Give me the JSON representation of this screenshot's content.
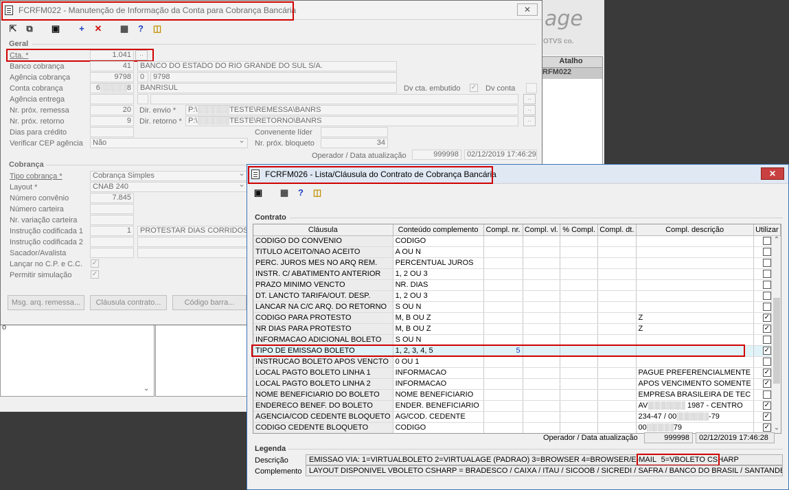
{
  "background": {
    "logo_text": "age",
    "logo_sub": "OTVS co.",
    "table_header": "Atalho",
    "table_cell": "RFM022",
    "stray_text": "o"
  },
  "win1": {
    "title": "FCRFM022 - Manutenção de Informação da Conta para Cobrança Bancária",
    "geral": {
      "group_label": "Geral",
      "cta_label": "Cta. *",
      "cta_value": "1.041",
      "banco_label": "Banco cobrança",
      "banco_code": "41",
      "banco_name": "BANCO DO ESTADO DO RIO GRANDE DO SUL S/A.",
      "agencia_label": "Agência cobrança",
      "agencia_code": "9798",
      "agencia_digit": "0",
      "agencia_name": "9798",
      "conta_label": "Conta cobrança",
      "conta_value": "6░░░░░8",
      "conta_name": "BANRISUL",
      "dv_embutido_label": "Dv cta. embutido",
      "dv_conta_label": "Dv conta",
      "agencia_entrega_label": "Agência entrega",
      "nr_remessa_label": "Nr. próx. remessa",
      "nr_remessa_value": "20",
      "dir_envio_label": "Dir. envio *",
      "dir_envio_value": "P:\\░░░░░░TESTE\\REMESSA\\BANRS",
      "nr_retorno_label": "Nr. próx. retorno",
      "nr_retorno_value": "9",
      "dir_retorno_label": "Dir. retorno *",
      "dir_retorno_value": "P:\\░░░░░░TESTE\\RETORNO\\BANRS",
      "dias_credito_label": "Dias para crédito",
      "convenente_label": "Convenente líder",
      "cep_label": "Verificar CEP agência",
      "cep_value": "Não",
      "nr_bloqueto_label": "Nr. próx. bloqueto",
      "nr_bloqueto_value": "34",
      "operador_label": "Operador / Data atualização",
      "operador_value": "999998",
      "data_value": "02/12/2019 17:46:29"
    },
    "cobranca": {
      "group_label": "Cobrança",
      "tipo_label": "Tipo cobrança *",
      "tipo_value": "Cobrança Simples",
      "layout_label": "Layout *",
      "layout_value": "CNAB 240",
      "convenio_label": "Número convênio",
      "convenio_value": "7.845",
      "carteira_label": "Número carteira",
      "variacao_label": "Nr. variação carteira",
      "instr1_label": "Instrução codificada 1",
      "instr1_value": "1",
      "instr1_desc": "PROTESTAR DIAS CORRIDOS",
      "instr2_label": "Instrução codificada 2",
      "sacador_label": "Sacador/Avalista",
      "lancar_label": "Lançar no C.P. e C.C.",
      "simulacao_label": "Permitir simulação"
    },
    "buttons": {
      "msg": "Msg. arq. remessa...",
      "clausula": "Cláusula contrato...",
      "codigo_barra": "Código barra..."
    }
  },
  "win2": {
    "title": "FCRFM026 - Lista/Cláusula do Contrato de Cobrança Bancária",
    "close": "✕",
    "group_label": "Contrato",
    "columns": [
      "Cláusula",
      "Conteúdo complemento",
      "Compl. nr.",
      "Compl. vl.",
      "% Compl.",
      "Compl. dt.",
      "Compl. descrição",
      "Utilizar"
    ],
    "rows": [
      {
        "clausula": "CODIGO DO CONVENIO",
        "conteudo": "CODIGO",
        "nr": "",
        "desc": "",
        "checked": false
      },
      {
        "clausula": "TITULO ACEITO/NAO ACEITO",
        "conteudo": "A OU N",
        "nr": "",
        "desc": "",
        "checked": false
      },
      {
        "clausula": "PERC. JUROS MES NO ARQ REM.",
        "conteudo": "PERCENTUAL JUROS",
        "nr": "",
        "desc": "",
        "checked": false
      },
      {
        "clausula": "INSTR. C/ ABATIMENTO ANTERIOR",
        "conteudo": "1, 2 OU 3",
        "nr": "",
        "desc": "",
        "checked": false
      },
      {
        "clausula": "PRAZO MINIMO VENCTO",
        "conteudo": "NR. DIAS",
        "nr": "",
        "desc": "",
        "checked": false
      },
      {
        "clausula": "DT. LANCTO TARIFA/OUT. DESP.",
        "conteudo": "1, 2 OU 3",
        "nr": "",
        "desc": "",
        "checked": false
      },
      {
        "clausula": "LANCAR NA C/C ARQ. DO RETORNO",
        "conteudo": "S OU N",
        "nr": "",
        "desc": "",
        "checked": false
      },
      {
        "clausula": "CODIGO PARA PROTESTO",
        "conteudo": "M, B OU Z",
        "nr": "",
        "desc": "Z",
        "checked": true
      },
      {
        "clausula": "NR DIAS PARA PROTESTO",
        "conteudo": "M, B OU Z",
        "nr": "",
        "desc": "Z",
        "checked": true
      },
      {
        "clausula": "INFORMACAO ADICIONAL BOLETO",
        "conteudo": "S OU N",
        "nr": "",
        "desc": "",
        "checked": false
      },
      {
        "clausula": "TIPO DE EMISSAO BOLETO",
        "conteudo": "1, 2,  3, 4, 5",
        "nr": "5",
        "desc": "",
        "checked": true
      },
      {
        "clausula": "INSTRUCAO BOLETO APOS VENCTO",
        "conteudo": "0 OU 1",
        "nr": "",
        "desc": "",
        "checked": false
      },
      {
        "clausula": "LOCAL PAGTO BOLETO LINHA 1",
        "conteudo": "INFORMACAO",
        "nr": "",
        "desc": "PAGUE PREFERENCIALMENTE",
        "checked": true
      },
      {
        "clausula": "LOCAL PAGTO BOLETO LINHA 2",
        "conteudo": "INFORMACAO",
        "nr": "",
        "desc": "APOS VENCIMENTO SOMENTE",
        "checked": true
      },
      {
        "clausula": "NOME BENEFICIARIO DO BOLETO",
        "conteudo": "NOME BENEFICIARIO",
        "nr": "",
        "desc": "EMPRESA BRASILEIRA DE TEC",
        "checked": false
      },
      {
        "clausula": "ENDERECO BENEF. DO BOLETO",
        "conteudo": "ENDER. BENEFICIARIO",
        "nr": "",
        "desc": "AV░░░░░░░ 1987 - CENTRO",
        "checked": true
      },
      {
        "clausula": "AGENCIA/COD CEDENTE BLOQUETO",
        "conteudo": "AG/COD. CEDENTE",
        "nr": "",
        "desc": "234-47 / 00░░░░░░-79",
        "checked": true
      },
      {
        "clausula": "CODIGO CEDENTE BLOQUETO",
        "conteudo": "CODIGO",
        "nr": "",
        "desc": "00░░░░░79",
        "checked": true
      }
    ],
    "operador_label": "Operador / Data atualização",
    "operador_value": "999998",
    "data_value": "02/12/2019 17:46:28",
    "legenda": {
      "group_label": "Legenda",
      "descricao_label": "Descrição",
      "descricao_value": "EMISSAO VIA: 1=VIRTUALBOLETO 2=VIRTUALAGE (PADRAO) 3=BROWSER 4=BROWSER/E-MAIL",
      "descricao_highlight": "5=VBOLETO CSHARP",
      "complemento_label": "Complemento",
      "complemento_value": "LAYOUT DISPONIVEL VBOLETO CSHARP = BRADESCO / CAIXA / ITAU / SICOOB / SICREDI / SAFRA / BANCO DO BRASIL / SANTANDER"
    }
  },
  "colors": {
    "highlight_red": "#d00000",
    "selected_row": "#e0f3f8",
    "active_title_bg": "#dfe8f3"
  }
}
